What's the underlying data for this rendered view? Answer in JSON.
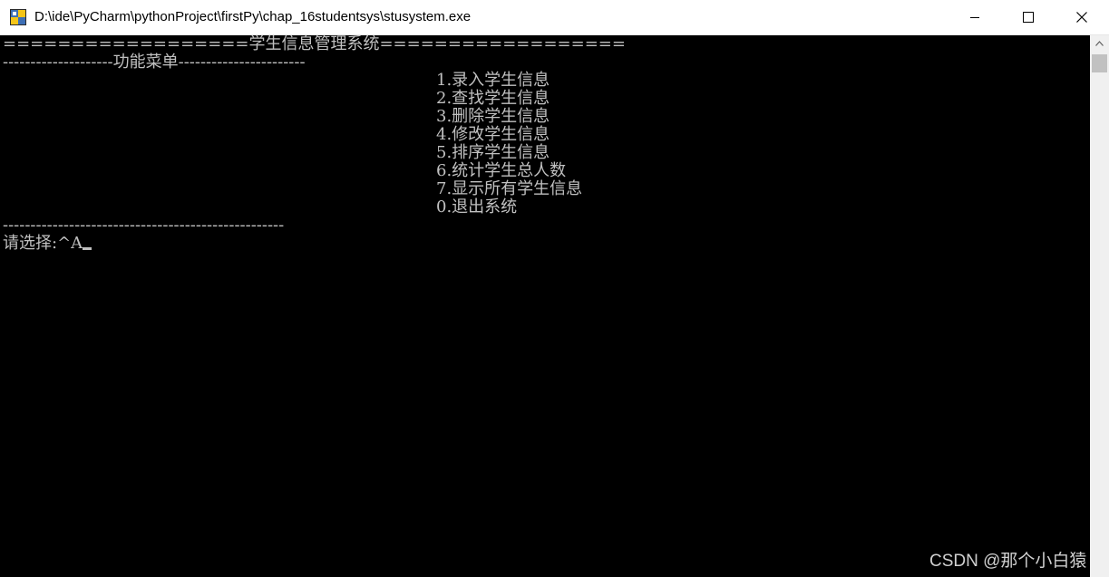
{
  "window": {
    "title": "D:\\ide\\PyCharm\\pythonProject\\firstPy\\chap_16studentsys\\stusystem.exe",
    "icon": "python-console-icon"
  },
  "console": {
    "header_line": "==================学生信息管理系统==================",
    "menu_title_line": "--------------------功能菜单-----------------------",
    "menu_items": [
      "1.录入学生信息",
      "2.查找学生信息",
      "3.删除学生信息",
      "4.修改学生信息",
      "5.排序学生信息",
      "6.统计学生总人数",
      "7.显示所有学生信息",
      "0.退出系统"
    ],
    "footer_line": "---------------------------------------------------",
    "prompt": "请选择:",
    "input": "^A"
  },
  "watermark": "CSDN @那个小白猿",
  "colors": {
    "console_bg": "#000000",
    "console_text": "#c0c0c0",
    "titlebar_bg": "#ffffff"
  }
}
